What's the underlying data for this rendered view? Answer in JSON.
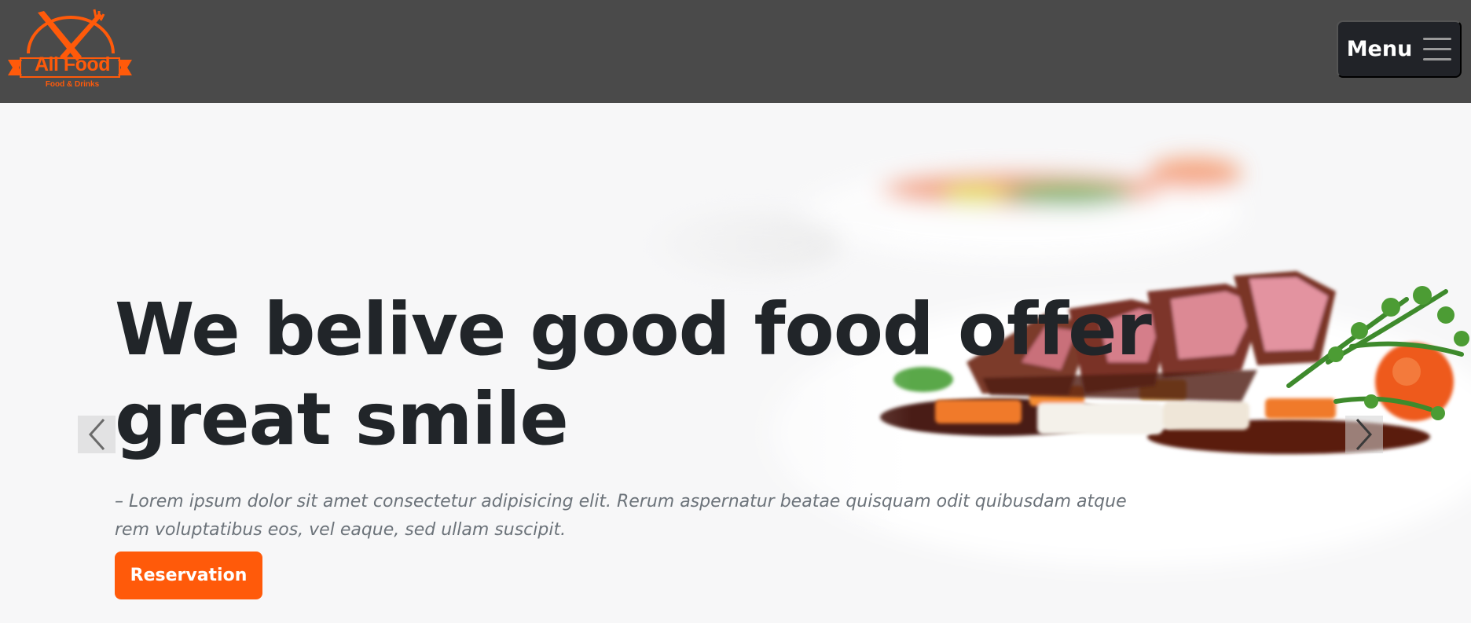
{
  "brand": {
    "name": "All Food",
    "tagline": "Food & Drinks",
    "color": "#ff5a0a"
  },
  "nav": {
    "menu_label": "Menu",
    "menu_icon": "hamburger-icon"
  },
  "hero": {
    "headline": "We belive good food offer great smile",
    "lead": "– Lorem ipsum dolor sit amet consectetur adipisicing elit. Rerum aspernatur beatae quisquam odit quibusdam atque rem voluptatibus eos, vel eaque, sed ullam suscipit.",
    "cta_label": "Reservation",
    "prev_icon": "chevron-left-icon",
    "next_icon": "chevron-right-icon"
  },
  "colors": {
    "navbar_bg": "#4a4a4a",
    "menu_button_bg": "#212328",
    "accent": "#ff5a0a",
    "headline": "#212529",
    "lead": "#6c737a"
  }
}
